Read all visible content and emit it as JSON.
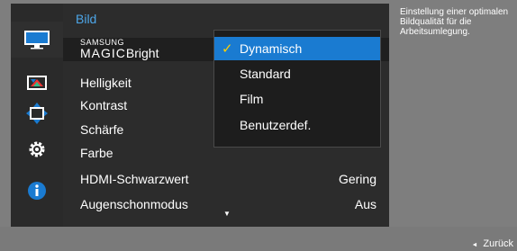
{
  "menu": {
    "title": "Bild",
    "items": [
      {
        "samsung": "SAMSUNG",
        "magic": "MAGIC",
        "bright": "Bright",
        "value": ""
      },
      {
        "label": "Helligkeit",
        "value": ""
      },
      {
        "label": "Kontrast",
        "value": ""
      },
      {
        "label": "Schärfe",
        "value": ""
      },
      {
        "label": "Farbe",
        "value": ""
      },
      {
        "label": "HDMI-Schwarzwert",
        "value": "Gering"
      },
      {
        "label": "Augenschonmodus",
        "value": "Aus"
      }
    ]
  },
  "dropdown": {
    "options": [
      "Dynamisch",
      "Standard",
      "Film",
      "Benutzerdef."
    ],
    "selected": "Dynamisch",
    "check_mark": "✓"
  },
  "help": {
    "text": "Einstellung einer optimalen Bildqualität für die Arbeitsumlegung."
  },
  "footer": {
    "back_label": "Zurück",
    "back_icon": "◄"
  },
  "scroll": {
    "down_icon": "▼"
  },
  "icons": [
    "picture-icon",
    "color-icon",
    "screen-position-icon",
    "settings-gear-icon",
    "info-icon"
  ],
  "colors": {
    "accent": "#1a7bd1",
    "title": "#4da6e8",
    "check": "#ffd000"
  }
}
